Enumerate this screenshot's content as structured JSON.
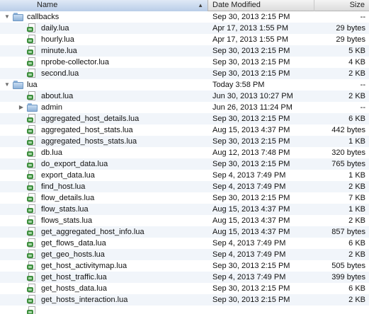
{
  "columns": {
    "name": "Name",
    "date": "Date Modified",
    "size": "Size"
  },
  "sort_indicator": "▲",
  "rows": [
    {
      "level": 0,
      "kind": "folder",
      "expanded": true,
      "name": "callbacks",
      "date": "Sep 30, 2013 2:15 PM",
      "size": "--"
    },
    {
      "level": 1,
      "kind": "file",
      "name": "daily.lua",
      "date": "Apr 17, 2013 1:55 PM",
      "size": "29 bytes"
    },
    {
      "level": 1,
      "kind": "file",
      "name": "hourly.lua",
      "date": "Apr 17, 2013 1:55 PM",
      "size": "29 bytes"
    },
    {
      "level": 1,
      "kind": "file",
      "name": "minute.lua",
      "date": "Sep 30, 2013 2:15 PM",
      "size": "5 KB"
    },
    {
      "level": 1,
      "kind": "file",
      "name": "nprobe-collector.lua",
      "date": "Sep 30, 2013 2:15 PM",
      "size": "4 KB"
    },
    {
      "level": 1,
      "kind": "file",
      "name": "second.lua",
      "date": "Sep 30, 2013 2:15 PM",
      "size": "2 KB"
    },
    {
      "level": 0,
      "kind": "folder",
      "expanded": true,
      "name": "lua",
      "date": "Today 3:58 PM",
      "size": "--"
    },
    {
      "level": 1,
      "kind": "file",
      "name": "about.lua",
      "date": "Jun 30, 2013 10:27 PM",
      "size": "2 KB"
    },
    {
      "level": 1,
      "kind": "folder",
      "expanded": false,
      "name": "admin",
      "date": "Jun 26, 2013 11:24 PM",
      "size": "--"
    },
    {
      "level": 1,
      "kind": "file",
      "name": "aggregated_host_details.lua",
      "date": "Sep 30, 2013 2:15 PM",
      "size": "6 KB"
    },
    {
      "level": 1,
      "kind": "file",
      "name": "aggregated_host_stats.lua",
      "date": "Aug 15, 2013 4:37 PM",
      "size": "442 bytes"
    },
    {
      "level": 1,
      "kind": "file",
      "name": "aggregated_hosts_stats.lua",
      "date": "Sep 30, 2013 2:15 PM",
      "size": "1 KB"
    },
    {
      "level": 1,
      "kind": "file",
      "name": "db.lua",
      "date": "Aug 12, 2013 7:48 PM",
      "size": "320 bytes"
    },
    {
      "level": 1,
      "kind": "file",
      "name": "do_export_data.lua",
      "date": "Sep 30, 2013 2:15 PM",
      "size": "765 bytes"
    },
    {
      "level": 1,
      "kind": "file",
      "name": "export_data.lua",
      "date": "Sep 4, 2013 7:49 PM",
      "size": "1 KB"
    },
    {
      "level": 1,
      "kind": "file",
      "name": "find_host.lua",
      "date": "Sep 4, 2013 7:49 PM",
      "size": "2 KB"
    },
    {
      "level": 1,
      "kind": "file",
      "name": "flow_details.lua",
      "date": "Sep 30, 2013 2:15 PM",
      "size": "7 KB"
    },
    {
      "level": 1,
      "kind": "file",
      "name": "flow_stats.lua",
      "date": "Aug 15, 2013 4:37 PM",
      "size": "1 KB"
    },
    {
      "level": 1,
      "kind": "file",
      "name": "flows_stats.lua",
      "date": "Aug 15, 2013 4:37 PM",
      "size": "2 KB"
    },
    {
      "level": 1,
      "kind": "file",
      "name": "get_aggregated_host_info.lua",
      "date": "Aug 15, 2013 4:37 PM",
      "size": "857 bytes"
    },
    {
      "level": 1,
      "kind": "file",
      "name": "get_flows_data.lua",
      "date": "Sep 4, 2013 7:49 PM",
      "size": "6 KB"
    },
    {
      "level": 1,
      "kind": "file",
      "name": "get_geo_hosts.lua",
      "date": "Sep 4, 2013 7:49 PM",
      "size": "2 KB"
    },
    {
      "level": 1,
      "kind": "file",
      "name": "get_host_activitymap.lua",
      "date": "Sep 30, 2013 2:15 PM",
      "size": "505 bytes"
    },
    {
      "level": 1,
      "kind": "file",
      "name": "get_host_traffic.lua",
      "date": "Sep 4, 2013 7:49 PM",
      "size": "399 bytes"
    },
    {
      "level": 1,
      "kind": "file",
      "name": "get_hosts_data.lua",
      "date": "Sep 30, 2013 2:15 PM",
      "size": "6 KB"
    },
    {
      "level": 1,
      "kind": "file",
      "name": "get_hosts_interaction.lua",
      "date": "Sep 30, 2013 2:15 PM",
      "size": "2 KB"
    },
    {
      "level": 1,
      "kind": "file",
      "name": "",
      "date": "",
      "size": ""
    }
  ]
}
